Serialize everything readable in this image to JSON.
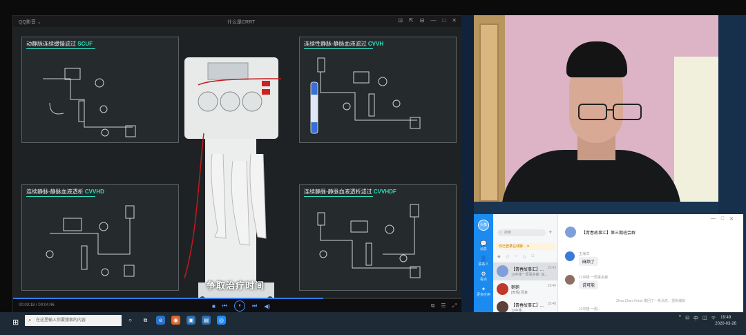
{
  "player": {
    "app_name": "QQ影音 ⌄",
    "window_title": "什么是CRRT",
    "title_controls": [
      "⊡",
      "⇱",
      "⊟",
      "—",
      "□",
      "✕"
    ],
    "subtitle": "争取治疗时间",
    "time": "00:03:18 / 00:04:46",
    "progress_fraction": 0.69,
    "panels": {
      "scuf": {
        "title": "动静脉连续缓慢滤过",
        "abbr": "SCUF"
      },
      "cvvh": {
        "title": "连续性静脉-静脉血液滤过",
        "abbr": "CVVH"
      },
      "cvvhd": {
        "title": "连续静脉-静脉血液透析",
        "abbr": "CVVHD"
      },
      "cvvhdf": {
        "title": "连续静脉-静脉血液透析滤过",
        "abbr": "CVVHDF"
      }
    },
    "control_icons": [
      "■",
      "⏮",
      "⏸",
      "⏭",
      "◀)"
    ],
    "right_icons": [
      "⧉",
      "☰",
      "⤢"
    ]
  },
  "qq": {
    "rail_avatar": "头像",
    "rail_items": [
      {
        "icon": "💬",
        "label": "消息"
      },
      {
        "icon": "👤",
        "label": "联系人"
      },
      {
        "icon": "⚙",
        "label": "看点"
      },
      {
        "icon": "✦",
        "label": "更多应用"
      }
    ],
    "search_placeholder": "搜索",
    "notice": "你已登录在线聊... ✕",
    "list_icons": [
      "◆",
      "◇",
      "○",
      "△",
      "□"
    ],
    "conversations": [
      {
        "name": "【青春故事汇】...",
        "preview": "12中楼一周事多被: 说...",
        "time": "19:43",
        "color": "#7e9fd8"
      },
      {
        "name": "鹅鹅",
        "preview": "[表情] 回复",
        "time": "19:40",
        "color": "#c0392b"
      },
      {
        "name": "【青春故事汇】...",
        "preview": "12中楼...",
        "time": "19:48",
        "color": "#5d4037"
      }
    ],
    "chat_title": "【青春故事汇】第三期班会群",
    "window_buttons": [
      "—",
      "□",
      "✕"
    ],
    "messages": [
      {
        "name": "王海洋",
        "text": "麻烦了",
        "color": "#3a7bd5"
      },
      {
        "name": "12中楼 一周事多被",
        "text": "说可能",
        "color": "#8d6e63"
      }
    ],
    "system_msg": "Zhou Zhan Hetao 撤回了一条消息，重新编辑",
    "last_sender": "12中楼 一周..."
  },
  "taskbar": {
    "start_icon": "⊞",
    "search_text": "在这里输入你要搜索的内容",
    "apps": [
      {
        "glyph": "○",
        "color": "transparent"
      },
      {
        "glyph": "⧉",
        "color": "transparent"
      },
      {
        "glyph": "e",
        "color": "#2a74c9"
      },
      {
        "glyph": "◉",
        "color": "#d9692a"
      },
      {
        "glyph": "▣",
        "color": "#2b6fb0"
      },
      {
        "glyph": "▤",
        "color": "#2b6fb0"
      },
      {
        "glyph": "◎",
        "color": "#1a8cff"
      }
    ],
    "tray": [
      "^",
      "⊡",
      "中",
      "◫",
      "ᯤ"
    ],
    "time": "19:49",
    "date": "2020-03-26"
  }
}
